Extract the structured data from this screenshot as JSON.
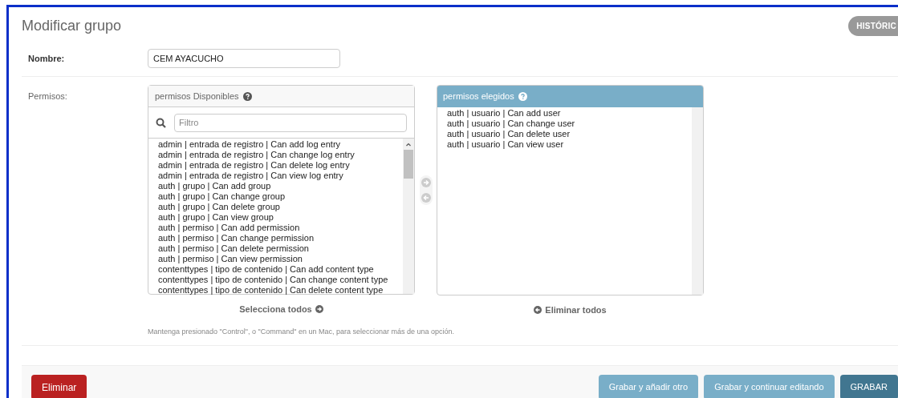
{
  "title": "Modificar grupo",
  "history_button": "HISTÓRIC",
  "name_field": {
    "label": "Nombre:",
    "value": "CEM AYACUCHO"
  },
  "permissions": {
    "label": "Permisos:",
    "available": {
      "title": "permisos Disponibles",
      "filter_placeholder": "Filtro",
      "items": [
        "admin | entrada de registro | Can add log entry",
        "admin | entrada de registro | Can change log entry",
        "admin | entrada de registro | Can delete log entry",
        "admin | entrada de registro | Can view log entry",
        "auth | grupo | Can add group",
        "auth | grupo | Can change group",
        "auth | grupo | Can delete group",
        "auth | grupo | Can view group",
        "auth | permiso | Can add permission",
        "auth | permiso | Can change permission",
        "auth | permiso | Can delete permission",
        "auth | permiso | Can view permission",
        "contenttypes | tipo de contenido | Can add content type",
        "contenttypes | tipo de contenido | Can change content type",
        "contenttypes | tipo de contenido | Can delete content type"
      ],
      "action": "Selecciona todos"
    },
    "chosen": {
      "title": "permisos elegidos",
      "items": [
        "auth | usuario | Can add user",
        "auth | usuario | Can change user",
        "auth | usuario | Can delete user",
        "auth | usuario | Can view user"
      ],
      "action": "Eliminar todos"
    },
    "help": "Mantenga presionado \"Control\", o \"Command\" en un Mac, para seleccionar más de una opción."
  },
  "buttons": [
    {
      "label": "Eliminar",
      "kind": "danger"
    },
    {
      "label": "Grabar y añadir otro",
      "kind": "secondary"
    },
    {
      "label": "Grabar y continuar editando",
      "kind": "secondary"
    },
    {
      "label": "GRABAR",
      "kind": "primary"
    }
  ]
}
